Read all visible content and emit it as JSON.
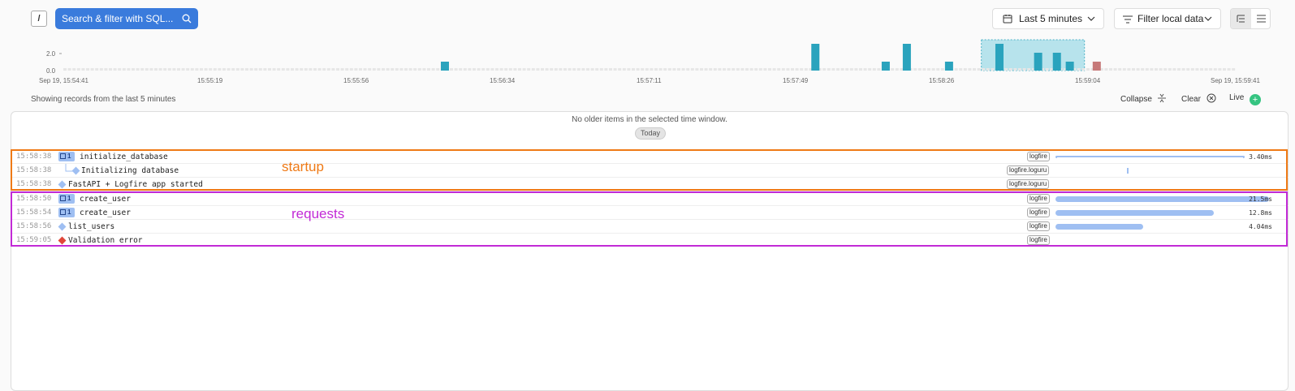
{
  "toolbar": {
    "slash_label": "/",
    "search_label": "Search & filter with SQL...",
    "time_range": "Last 5 minutes",
    "filter_label": "Filter local data"
  },
  "histogram": {
    "y_ticks": [
      "2.0",
      "0.0"
    ],
    "x_ticks": [
      "Sep 19, 15:54:41",
      "15:55:19",
      "15:55:56",
      "15:56:34",
      "15:57:11",
      "15:57:49",
      "15:58:26",
      "15:59:04",
      "Sep 19, 15:59:41"
    ],
    "colors": {
      "bar": "#2aa3bd",
      "error_bar": "#c77a7a",
      "selection": "#a6dde8"
    },
    "counts": [
      {
        "at": 0.322,
        "value": 1,
        "color": "#2aa3bd"
      },
      {
        "at": 0.638,
        "value": 3,
        "color": "#2aa3bd"
      },
      {
        "at": 0.698,
        "value": 1,
        "color": "#2aa3bd"
      },
      {
        "at": 0.716,
        "value": 3,
        "color": "#2aa3bd"
      },
      {
        "at": 0.752,
        "value": 1,
        "color": "#2aa3bd"
      },
      {
        "at": 0.795,
        "value": 3,
        "color": "#2aa3bd"
      },
      {
        "at": 0.828,
        "value": 2,
        "color": "#2aa3bd"
      },
      {
        "at": 0.844,
        "value": 2,
        "color": "#2aa3bd"
      },
      {
        "at": 0.855,
        "value": 1,
        "color": "#2aa3bd"
      },
      {
        "at": 0.878,
        "value": 1,
        "color": "#c77a7a"
      }
    ],
    "y_max": 3
  },
  "status": {
    "showing": "Showing records from the last 5 minutes",
    "collapse": "Collapse",
    "clear": "Clear",
    "live": "Live",
    "live_icon": "+"
  },
  "list": {
    "no_older": "No older items in the selected time window.",
    "today": "Today"
  },
  "rows": [
    {
      "ts": "15:58:38",
      "name": "initialize_database",
      "badge": "logfire",
      "count": "1",
      "duration": "3.40ms",
      "bar_fraction": 1.0
    },
    {
      "ts": "15:58:38",
      "name": "Initializing database",
      "badge": "logfire.loguru"
    },
    {
      "ts": "15:58:38",
      "name": "FastAPI + Logfire app started",
      "badge": "logfire.loguru"
    },
    {
      "ts": "15:58:50",
      "name": "create_user",
      "badge": "logfire",
      "count": "1",
      "duration": "21.5ms",
      "bar_fraction": 1.0
    },
    {
      "ts": "15:58:54",
      "name": "create_user",
      "badge": "logfire",
      "count": "1",
      "duration": "12.8ms",
      "bar_fraction": 0.74
    },
    {
      "ts": "15:58:56",
      "name": "list_users",
      "badge": "logfire",
      "duration": "4.04ms",
      "bar_fraction": 0.41
    },
    {
      "ts": "15:59:05",
      "name": "Validation error",
      "badge": "logfire"
    }
  ],
  "annotations": {
    "startup": "startup",
    "requests": "requests",
    "startup_color": "#ef7a16",
    "requests_color": "#c22ad6"
  }
}
